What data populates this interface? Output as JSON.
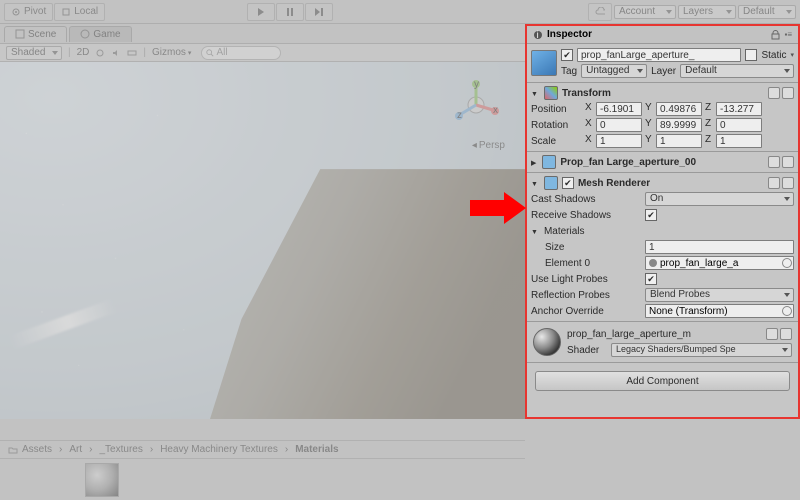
{
  "toolbar": {
    "pivot": "Pivot",
    "local": "Local",
    "account": "Account",
    "layers": "Layers",
    "default": "Default"
  },
  "tabs": {
    "scene": "Scene",
    "game": "Game",
    "inspector": "Inspector"
  },
  "scene_toolbar": {
    "shaded": "Shaded",
    "twoD": "2D",
    "gizmos": "Gizmos",
    "persp": "Persp",
    "search_placeholder": "All"
  },
  "inspector": {
    "obj_name": "prop_fanLarge_aperture_",
    "static": "Static",
    "tag_label": "Tag",
    "tag_value": "Untagged",
    "layer_label": "Layer",
    "layer_value": "Default",
    "transform": {
      "title": "Transform",
      "position_label": "Position",
      "rotation_label": "Rotation",
      "scale_label": "Scale",
      "position": {
        "x": "-6.1901",
        "y": "0.49876",
        "z": "-13.277"
      },
      "rotation": {
        "x": "0",
        "y": "89.9999",
        "z": "0"
      },
      "scale": {
        "x": "1",
        "y": "1",
        "z": "1"
      }
    },
    "mesh_filter_title": "Prop_fan Large_aperture_00",
    "mesh_renderer": {
      "title": "Mesh Renderer",
      "cast_shadows_label": "Cast Shadows",
      "cast_shadows_value": "On",
      "receive_shadows_label": "Receive Shadows",
      "materials_label": "Materials",
      "size_label": "Size",
      "size_value": "1",
      "element0_label": "Element 0",
      "element0_value": "prop_fan_large_a",
      "light_probes_label": "Use Light Probes",
      "reflection_probes_label": "Reflection Probes",
      "reflection_probes_value": "Blend Probes",
      "anchor_label": "Anchor Override",
      "anchor_value": "None (Transform)"
    },
    "material": {
      "name": "prop_fan_large_aperture_m",
      "shader_label": "Shader",
      "shader_value": "Legacy Shaders/Bumped Spe"
    },
    "add_component": "Add Component"
  },
  "breadcrumbs": [
    "Assets",
    "Art",
    "_Textures",
    "Heavy Machinery Textures",
    "Materials"
  ]
}
